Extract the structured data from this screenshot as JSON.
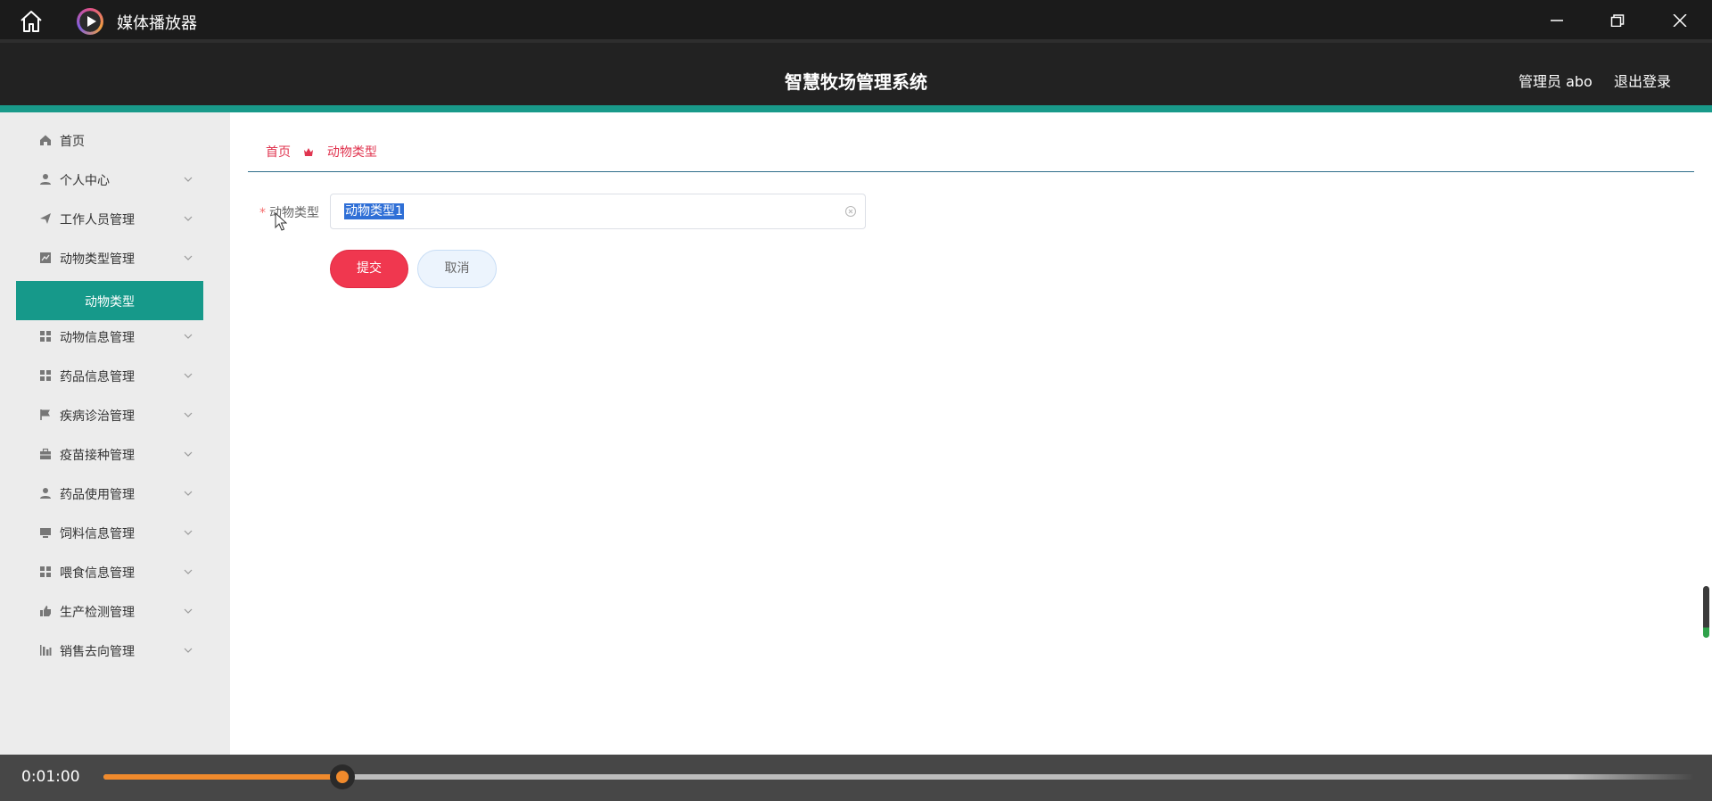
{
  "player": {
    "title": "媒体播放器",
    "current_time": "0:01:00",
    "progress_fraction": 0.15,
    "accent_color": "#f08a2c"
  },
  "header": {
    "title": "智慧牧场管理系统",
    "admin_label": "管理员 abo",
    "logout_label": "退出登录",
    "brand_color": "#199a8a"
  },
  "sidebar": {
    "items": [
      {
        "label": "首页",
        "icon": "home-icon",
        "expandable": false
      },
      {
        "label": "个人中心",
        "icon": "user-icon",
        "expandable": true
      },
      {
        "label": "工作人员管理",
        "icon": "send-icon",
        "expandable": true
      },
      {
        "label": "动物类型管理",
        "icon": "chart-icon",
        "expandable": true
      },
      {
        "label": "动物类型",
        "icon": "",
        "expandable": false,
        "active": true
      },
      {
        "label": "动物信息管理",
        "icon": "grid-icon",
        "expandable": true
      },
      {
        "label": "药品信息管理",
        "icon": "grid-icon",
        "expandable": true
      },
      {
        "label": "疾病诊治管理",
        "icon": "flag-icon",
        "expandable": true
      },
      {
        "label": "疫苗接种管理",
        "icon": "briefcase-icon",
        "expandable": true
      },
      {
        "label": "药品使用管理",
        "icon": "user-icon",
        "expandable": true
      },
      {
        "label": "饲料信息管理",
        "icon": "monitor-icon",
        "expandable": true
      },
      {
        "label": "喂食信息管理",
        "icon": "grid-icon",
        "expandable": true
      },
      {
        "label": "生产检测管理",
        "icon": "thumbs-up-icon",
        "expandable": true
      },
      {
        "label": "销售去向管理",
        "icon": "bar-chart-icon",
        "expandable": true
      }
    ]
  },
  "breadcrumb": {
    "home": "首页",
    "current": "动物类型"
  },
  "form": {
    "field_label": "动物类型",
    "required_mark": "*",
    "field_value": "动物类型1",
    "submit_label": "提交",
    "cancel_label": "取消"
  }
}
